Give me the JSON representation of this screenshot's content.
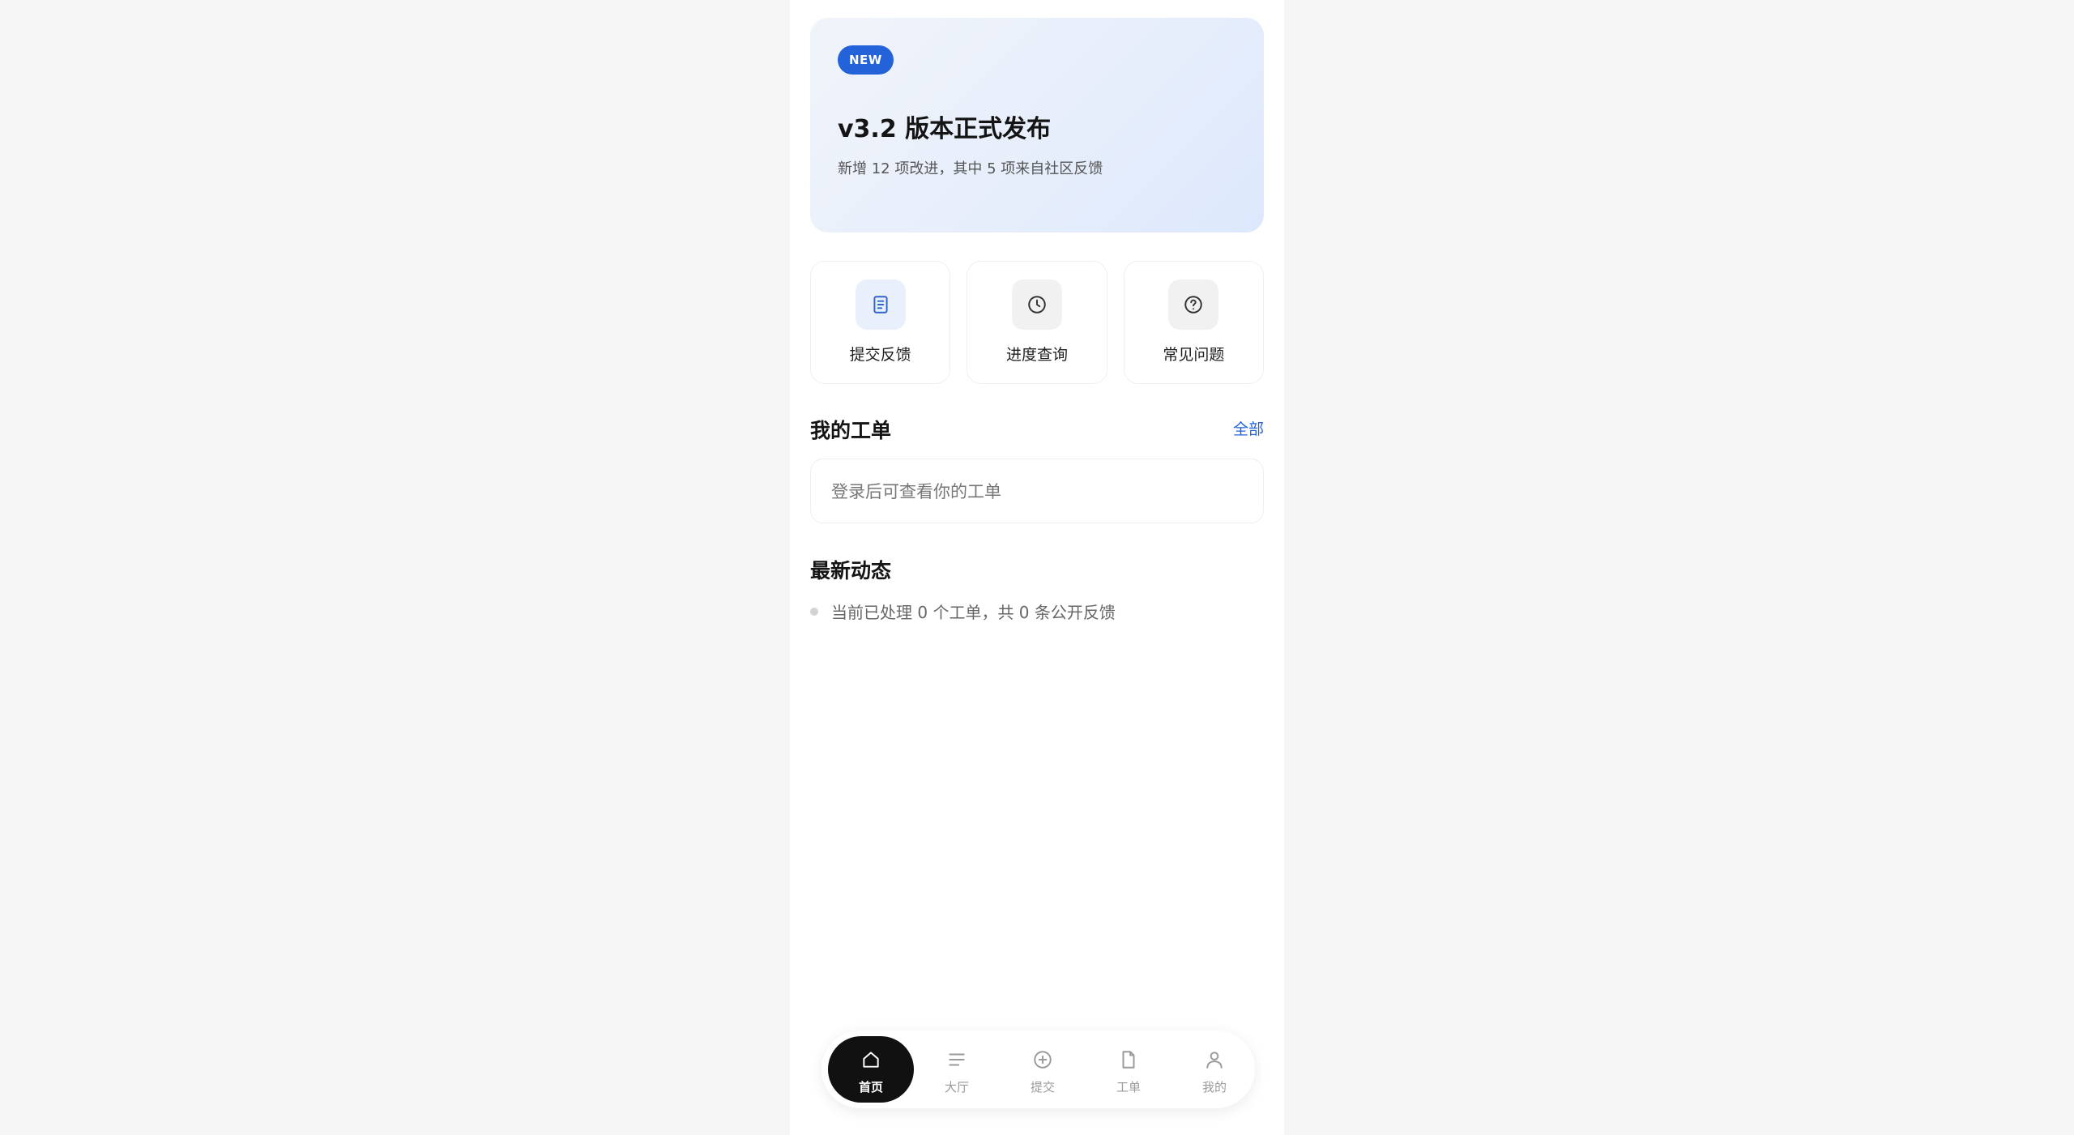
{
  "banner": {
    "badge": "NEW",
    "title": "v3.2 版本正式发布",
    "subtitle": "新增 12 项改进，其中 5 项来自社区反馈"
  },
  "actions": [
    {
      "label": "提交反馈",
      "icon": "document-icon"
    },
    {
      "label": "进度查询",
      "icon": "clock-icon"
    },
    {
      "label": "常见问题",
      "icon": "question-icon"
    }
  ],
  "tickets": {
    "title": "我的工单",
    "link": "全部",
    "empty_text": "登录后可查看你的工单"
  },
  "news": {
    "title": "最新动态",
    "items": [
      "当前已处理 0 个工单，共 0 条公开反馈"
    ]
  },
  "tabbar": {
    "active": "首页",
    "items": [
      {
        "label": "首页",
        "icon": "home-icon"
      },
      {
        "label": "大厅",
        "icon": "list-icon"
      },
      {
        "label": "提交",
        "icon": "plus-circle-icon"
      },
      {
        "label": "工单",
        "icon": "file-icon"
      },
      {
        "label": "我的",
        "icon": "user-icon"
      }
    ]
  },
  "colors": {
    "accent": "#2362d8",
    "background": "#f5f5f5",
    "active_tab": "#111111"
  }
}
